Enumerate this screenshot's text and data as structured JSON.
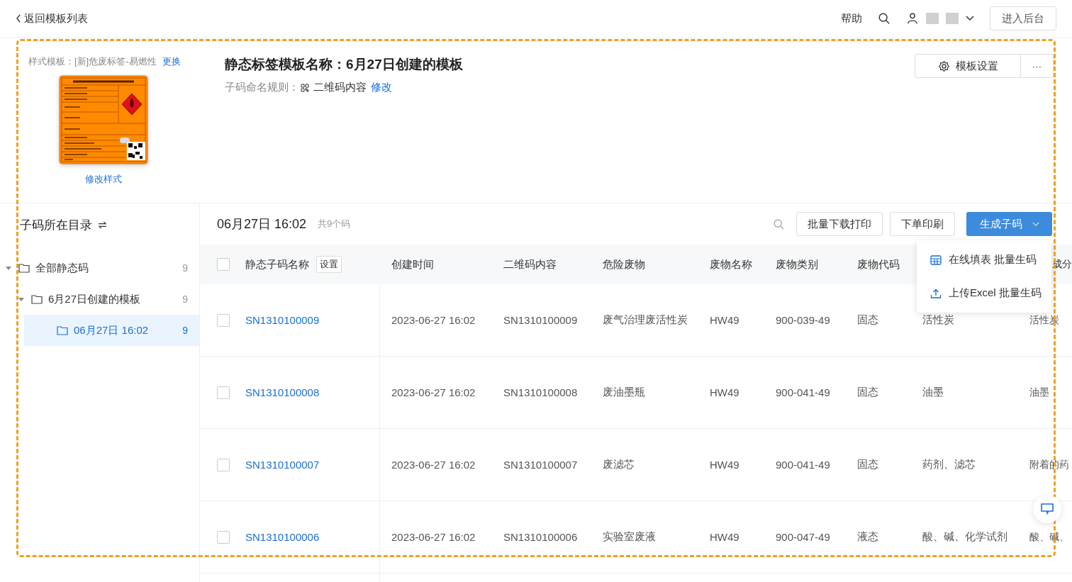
{
  "top_bar": {
    "back_link": "返回模板列表",
    "help": "帮助",
    "admin_button": "进入后台"
  },
  "template": {
    "style_label": "样式模板：[新]危废标签-易燃性",
    "replace_link": "更换",
    "edit_style_link": "修改样式",
    "title": "静态标签模板名称：6月27日创建的模板",
    "naming_label": "子码命名规则：",
    "naming_value": "二维码内容",
    "naming_edit": "修改",
    "settings_button": "模板设置",
    "more_button": "···"
  },
  "sidebar": {
    "title": "子码所在目录",
    "tree": [
      {
        "label": "全部静态码",
        "count": "9",
        "expanded": true,
        "selected": false,
        "children": [
          {
            "label": "6月27日创建的模板",
            "count": "9",
            "expanded": true,
            "selected": false,
            "children": [
              {
                "label": "06月27日 16:02",
                "count": "9",
                "selected": true
              }
            ]
          }
        ]
      }
    ]
  },
  "list": {
    "title": "06月27日 16:02",
    "total": "共9个码",
    "buttons": [
      "批量下载打印",
      "下单印刷"
    ],
    "generate_button": "生成子码",
    "menu": [
      {
        "kind": "table",
        "label": "在线填表 批量生码"
      },
      {
        "kind": "upload",
        "label": "上传Excel 批量生码"
      }
    ]
  },
  "table": {
    "all_checked": false,
    "columns": [
      "静态子码名称",
      "创建时间",
      "二维码内容",
      "危险废物",
      "废物名称",
      "废物类别",
      "废物代码"
    ],
    "column_settings": "设置",
    "last_column": "成分",
    "rows": [
      {
        "checked": false,
        "cells": [
          "SN1310100009",
          "2023-06-27 16:02",
          "SN1310100009",
          "废气治理废活性炭",
          "HW49",
          "900-039-49",
          "固态",
          "活性炭",
          "活性炭"
        ]
      },
      {
        "checked": false,
        "cells": [
          "SN1310100008",
          "2023-06-27 16:02",
          "SN1310100008",
          "废油墨瓶",
          "HW49",
          "900-041-49",
          "固态",
          "油墨",
          "油墨"
        ]
      },
      {
        "checked": false,
        "cells": [
          "SN1310100007",
          "2023-06-27 16:02",
          "SN1310100007",
          "废滤芯",
          "HW49",
          "900-041-49",
          "固态",
          "药剂、滤芯",
          "附着的药"
        ]
      },
      {
        "checked": false,
        "cells": [
          "SN1310100006",
          "2023-06-27 16:02",
          "SN1310100006",
          "实验室废液",
          "HW49",
          "900-047-49",
          "液态",
          "酸、碱、化学试剂",
          "酸、碱、"
        ]
      }
    ]
  }
}
